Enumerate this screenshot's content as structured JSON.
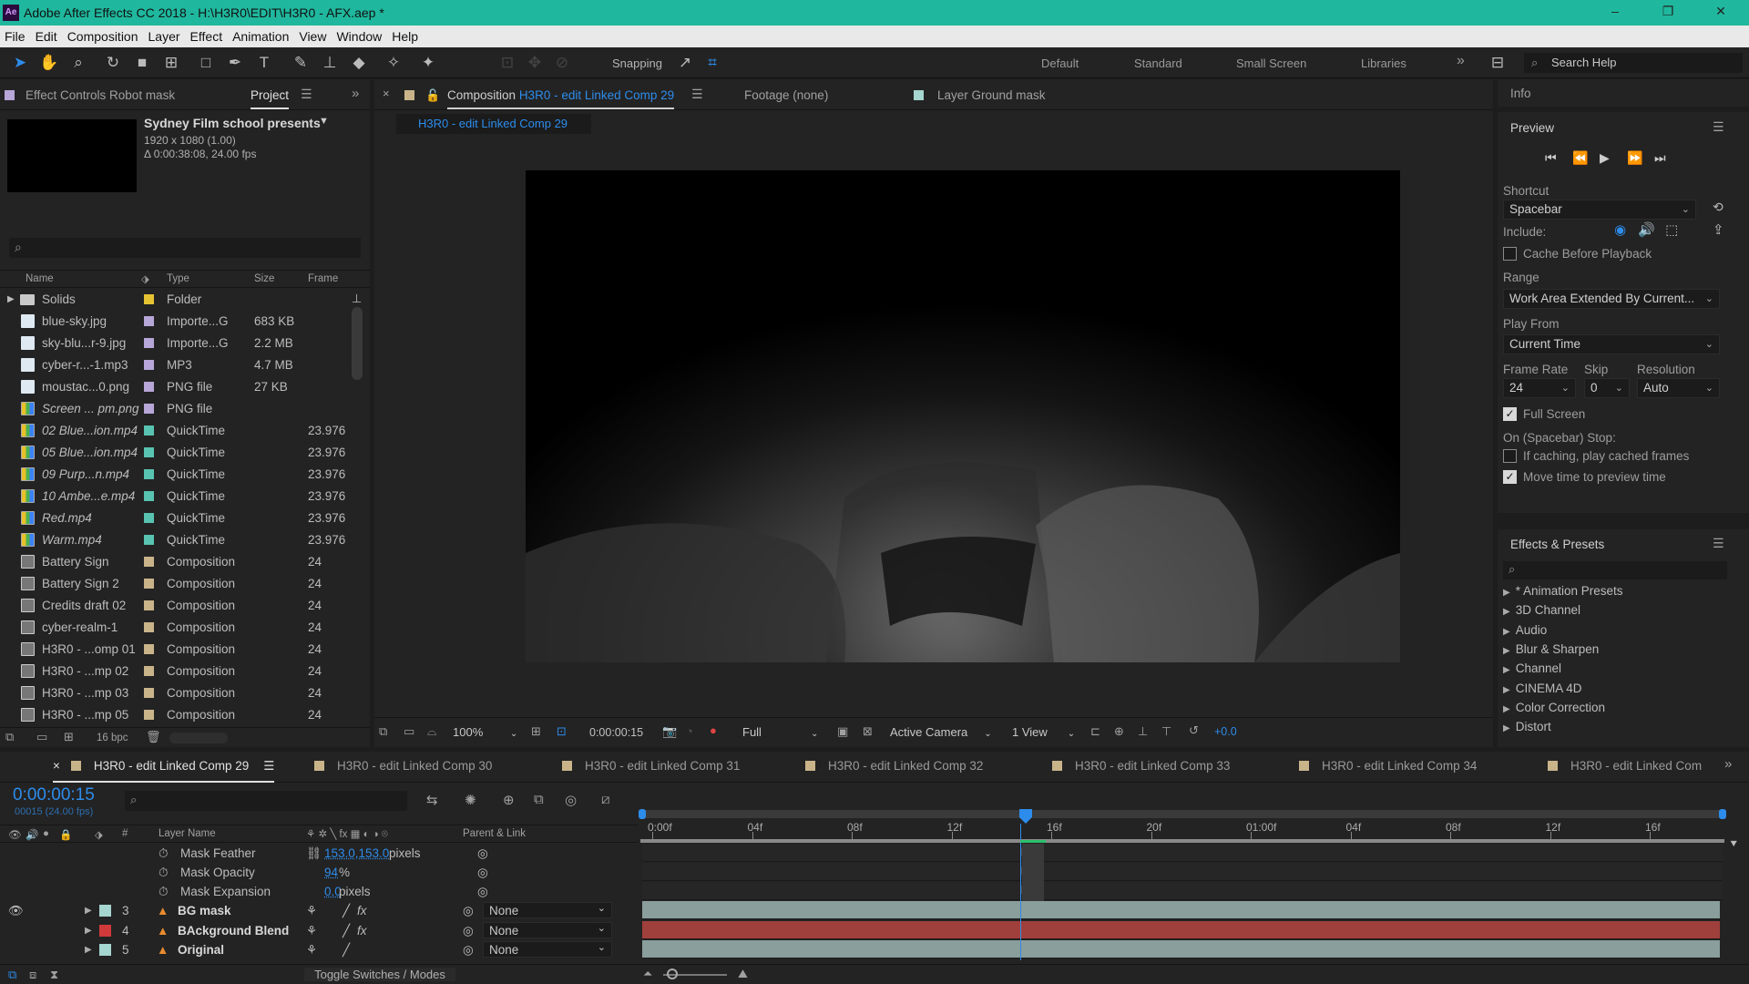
{
  "titlebar": {
    "app_icon": "Ae",
    "title": "Adobe After Effects CC 2018 - H:\\H3R0\\EDIT\\H3R0 - AFX.aep *",
    "buttons": [
      "–",
      "❐",
      "✕"
    ]
  },
  "menu": [
    "File",
    "Edit",
    "Composition",
    "Layer",
    "Effect",
    "Animation",
    "View",
    "Window",
    "Help"
  ],
  "toolbar": {
    "snapping_label": "Snapping",
    "workspaces": [
      "Default",
      "Standard",
      "Small Screen",
      "Libraries"
    ],
    "more": "»",
    "search_help": "Search Help"
  },
  "project_panel": {
    "tab_effect_controls": "Effect Controls Robot mask",
    "tab_project": "Project",
    "comp_name": "Sydney Film school presents",
    "comp_res": "1920 x 1080 (1.00)",
    "comp_duration": "Δ 0:00:38:08, 24.00 fps",
    "columns": [
      "Name",
      "Type",
      "Size",
      "Frame"
    ],
    "bpc": "16 bpc",
    "items": [
      {
        "name": "Solids",
        "type": "Folder",
        "size": "",
        "frame": "",
        "icon": "folder",
        "label": "#e5c232",
        "italic": false
      },
      {
        "name": "blue-sky.jpg",
        "type": "Importe...G",
        "size": "683 KB",
        "frame": "",
        "icon": "image",
        "label": "#b7a6d8",
        "italic": false
      },
      {
        "name": "sky-blu...r-9.jpg",
        "type": "Importe...G",
        "size": "2.2 MB",
        "frame": "",
        "icon": "image",
        "label": "#b7a6d8",
        "italic": false
      },
      {
        "name": "cyber-r...-1.mp3",
        "type": "MP3",
        "size": "4.7 MB",
        "frame": "",
        "icon": "audio",
        "label": "#b7a6d8",
        "italic": false
      },
      {
        "name": "moustac...0.png",
        "type": "PNG file",
        "size": "27 KB",
        "frame": "",
        "icon": "image",
        "label": "#b7a6d8",
        "italic": false
      },
      {
        "name": "Screen ... pm.png",
        "type": "PNG file",
        "size": "",
        "frame": "",
        "icon": "color",
        "label": "#b7a6d8",
        "italic": true
      },
      {
        "name": "02 Blue...ion.mp4",
        "type": "QuickTime",
        "size": "",
        "frame": "23.976",
        "icon": "color",
        "label": "#58c3b0",
        "italic": true
      },
      {
        "name": "05 Blue...ion.mp4",
        "type": "QuickTime",
        "size": "",
        "frame": "23.976",
        "icon": "color",
        "label": "#58c3b0",
        "italic": true
      },
      {
        "name": "09 Purp...n.mp4",
        "type": "QuickTime",
        "size": "",
        "frame": "23.976",
        "icon": "color",
        "label": "#58c3b0",
        "italic": true
      },
      {
        "name": "10 Ambe...e.mp4",
        "type": "QuickTime",
        "size": "",
        "frame": "23.976",
        "icon": "color",
        "label": "#58c3b0",
        "italic": true
      },
      {
        "name": "Red.mp4",
        "type": "QuickTime",
        "size": "",
        "frame": "23.976",
        "icon": "color",
        "label": "#58c3b0",
        "italic": true
      },
      {
        "name": "Warm.mp4",
        "type": "QuickTime",
        "size": "",
        "frame": "23.976",
        "icon": "color",
        "label": "#58c3b0",
        "italic": true
      },
      {
        "name": "Battery Sign",
        "type": "Composition",
        "size": "",
        "frame": "24",
        "icon": "comp",
        "label": "#c9b48a",
        "italic": false
      },
      {
        "name": "Battery Sign 2",
        "type": "Composition",
        "size": "",
        "frame": "24",
        "icon": "comp",
        "label": "#c9b48a",
        "italic": false
      },
      {
        "name": "Credits draft 02",
        "type": "Composition",
        "size": "",
        "frame": "24",
        "icon": "comp",
        "label": "#c9b48a",
        "italic": false
      },
      {
        "name": "cyber-realm-1",
        "type": "Composition",
        "size": "",
        "frame": "24",
        "icon": "comp",
        "label": "#c9b48a",
        "italic": false
      },
      {
        "name": "H3R0 - ...omp 01",
        "type": "Composition",
        "size": "",
        "frame": "24",
        "icon": "comp",
        "label": "#c9b48a",
        "italic": false
      },
      {
        "name": "H3R0 - ...mp 02",
        "type": "Composition",
        "size": "",
        "frame": "24",
        "icon": "comp",
        "label": "#c9b48a",
        "italic": false
      },
      {
        "name": "H3R0 - ...mp 03",
        "type": "Composition",
        "size": "",
        "frame": "24",
        "icon": "comp",
        "label": "#c9b48a",
        "italic": false
      },
      {
        "name": "H3R0 - ...mp 05",
        "type": "Composition",
        "size": "",
        "frame": "24",
        "icon": "comp",
        "label": "#c9b48a",
        "italic": false
      }
    ]
  },
  "viewer": {
    "tab_composition_prefix": "Composition",
    "tab_composition_name": "H3R0 - edit Linked Comp 29",
    "tab_footage": "Footage (none)",
    "tab_layer": "Layer  Ground mask",
    "breadcrumb": "H3R0 - edit Linked Comp 29",
    "zoom": "100%",
    "timecode": "0:00:00:15",
    "resolution": "Full",
    "camera": "Active Camera",
    "views": "1 View",
    "exposure": "+0.0"
  },
  "info_panel": {
    "title": "Info"
  },
  "preview_panel": {
    "title": "Preview",
    "shortcut_label": "Shortcut",
    "shortcut_value": "Spacebar",
    "include_label": "Include:",
    "cache_before_playback": "Cache Before Playback",
    "range_label": "Range",
    "range_value": "Work Area Extended By Current...",
    "play_from_label": "Play From",
    "play_from_value": "Current Time",
    "frame_rate_label": "Frame Rate",
    "frame_rate_value": "24",
    "skip_label": "Skip",
    "skip_value": "0",
    "resolution_label": "Resolution",
    "resolution_value": "Auto",
    "full_screen": "Full Screen",
    "on_stop_label": "On (Spacebar) Stop:",
    "if_caching": "If caching, play cached frames",
    "move_time": "Move time to preview time"
  },
  "effects_panel": {
    "title": "Effects & Presets",
    "categories": [
      "* Animation Presets",
      "3D Channel",
      "Audio",
      "Blur & Sharpen",
      "Channel",
      "CINEMA 4D",
      "Color Correction",
      "Distort"
    ]
  },
  "timeline": {
    "tabs": [
      {
        "label": "H3R0 - edit Linked Comp 29",
        "active": true
      },
      {
        "label": "H3R0 - edit Linked Comp 30",
        "active": false
      },
      {
        "label": "H3R0 - edit Linked Comp 31",
        "active": false
      },
      {
        "label": "H3R0 - edit Linked Comp 32",
        "active": false
      },
      {
        "label": "H3R0 - edit Linked Comp 33",
        "active": false
      },
      {
        "label": "H3R0 - edit Linked Comp 34",
        "active": false
      },
      {
        "label": "H3R0 - edit Linked Com",
        "active": false
      }
    ],
    "current_time": "0:00:00:15",
    "frame_info": "00015 (24.00 fps)",
    "columns": {
      "num": "#",
      "layer_name": "Layer Name",
      "parent": "Parent & Link"
    },
    "properties": [
      {
        "name": "Mask Feather",
        "value": "153.0,153.0",
        "unit": "pixels"
      },
      {
        "name": "Mask Opacity",
        "value": "94",
        "unit": "%"
      },
      {
        "name": "Mask Expansion",
        "value": "0.0",
        "unit": "pixels"
      }
    ],
    "layers": [
      {
        "num": "3",
        "name": "BG mask",
        "label": "#a5d6d0",
        "parent": "None",
        "fx": true,
        "track_color": "#8a9e9c"
      },
      {
        "num": "4",
        "name": "BAckground Blend",
        "label": "#d13a3a",
        "parent": "None",
        "fx": true,
        "track_color": "#a0403d"
      },
      {
        "num": "5",
        "name": "Original",
        "label": "#a5d6d0",
        "parent": "None",
        "fx": false,
        "track_color": "#8a9e9c"
      }
    ],
    "ruler": [
      "0:00f",
      "04f",
      "08f",
      "12f",
      "16f",
      "20f",
      "01:00f",
      "04f",
      "08f",
      "12f",
      "16f"
    ],
    "toggle_label": "Toggle Switches / Modes"
  }
}
